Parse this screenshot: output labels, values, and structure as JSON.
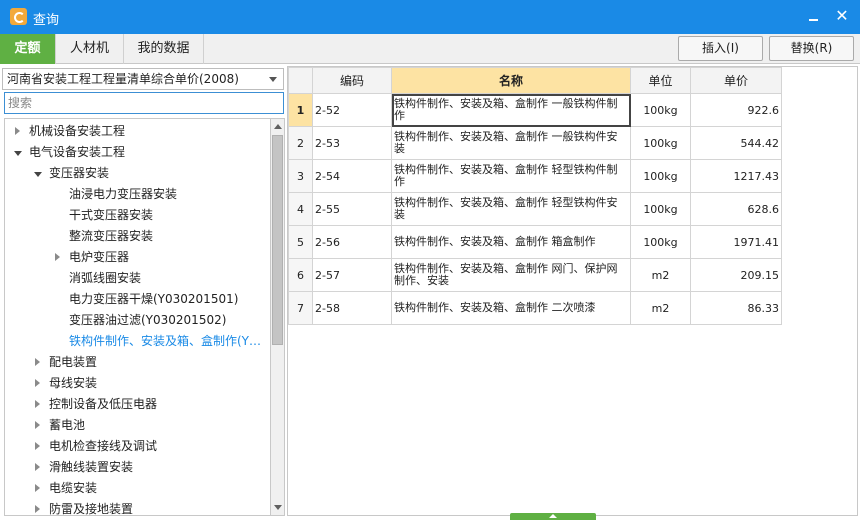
{
  "window": {
    "title": "查询",
    "minimize": "",
    "close": "✕"
  },
  "tabs": [
    {
      "label": "定额",
      "active": true
    },
    {
      "label": "人材机",
      "active": false
    },
    {
      "label": "我的数据",
      "active": false
    }
  ],
  "toolbar": {
    "insert_label": "插入(I)",
    "replace_label": "替换(R)"
  },
  "left": {
    "library": "河南省安装工程工程量清单综合单价(2008)",
    "search_placeholder": "搜索"
  },
  "tree": [
    {
      "label": "机械设备安装工程",
      "level": 0,
      "state": "collapsed"
    },
    {
      "label": "电气设备安装工程",
      "level": 0,
      "state": "expanded"
    },
    {
      "label": "变压器安装",
      "level": 1,
      "state": "expanded"
    },
    {
      "label": "油浸电力变压器安装",
      "level": 2,
      "state": "leaf"
    },
    {
      "label": "干式变压器安装",
      "level": 2,
      "state": "leaf"
    },
    {
      "label": "整流变压器安装",
      "level": 2,
      "state": "leaf"
    },
    {
      "label": "电炉变压器",
      "level": 2,
      "state": "collapsed"
    },
    {
      "label": "消弧线圈安装",
      "level": 2,
      "state": "leaf"
    },
    {
      "label": "电力变压器干燥(Y030201501)",
      "level": 2,
      "state": "leaf"
    },
    {
      "label": "变压器油过滤(Y030201502)",
      "level": 2,
      "state": "leaf"
    },
    {
      "label": "铁构件制作、安装及箱、盒制作(Y…",
      "level": 2,
      "state": "leaf",
      "selected": true
    },
    {
      "label": "配电装置",
      "level": 1,
      "state": "collapsed"
    },
    {
      "label": "母线安装",
      "level": 1,
      "state": "collapsed"
    },
    {
      "label": "控制设备及低压电器",
      "level": 1,
      "state": "collapsed"
    },
    {
      "label": "蓄电池",
      "level": 1,
      "state": "collapsed"
    },
    {
      "label": "电机检查接线及调试",
      "level": 1,
      "state": "collapsed"
    },
    {
      "label": "滑触线装置安装",
      "level": 1,
      "state": "collapsed"
    },
    {
      "label": "电缆安装",
      "level": 1,
      "state": "collapsed"
    },
    {
      "label": "防雷及接地装置",
      "level": 1,
      "state": "collapsed"
    }
  ],
  "grid": {
    "headers": {
      "code": "编码",
      "name": "名称",
      "unit": "单位",
      "price": "单价"
    },
    "rows": [
      {
        "idx": "1",
        "code": "2-52",
        "name": "铁构件制作、安装及箱、盒制作 一般铁构件制作",
        "unit": "100kg",
        "price": "922.6"
      },
      {
        "idx": "2",
        "code": "2-53",
        "name": "铁构件制作、安装及箱、盒制作 一般铁构件安装",
        "unit": "100kg",
        "price": "544.42"
      },
      {
        "idx": "3",
        "code": "2-54",
        "name": "铁构件制作、安装及箱、盒制作 轻型铁构件制作",
        "unit": "100kg",
        "price": "1217.43"
      },
      {
        "idx": "4",
        "code": "2-55",
        "name": "铁构件制作、安装及箱、盒制作 轻型铁构件安装",
        "unit": "100kg",
        "price": "628.6"
      },
      {
        "idx": "5",
        "code": "2-56",
        "name": "铁构件制作、安装及箱、盒制作 箱盒制作",
        "unit": "100kg",
        "price": "1971.41"
      },
      {
        "idx": "6",
        "code": "2-57",
        "name": "铁构件制作、安装及箱、盒制作 网门、保护网制作、安装",
        "unit": "m2",
        "price": "209.15"
      },
      {
        "idx": "7",
        "code": "2-58",
        "name": "铁构件制作、安装及箱、盒制作 二次喷漆",
        "unit": "m2",
        "price": "86.33"
      }
    ]
  }
}
